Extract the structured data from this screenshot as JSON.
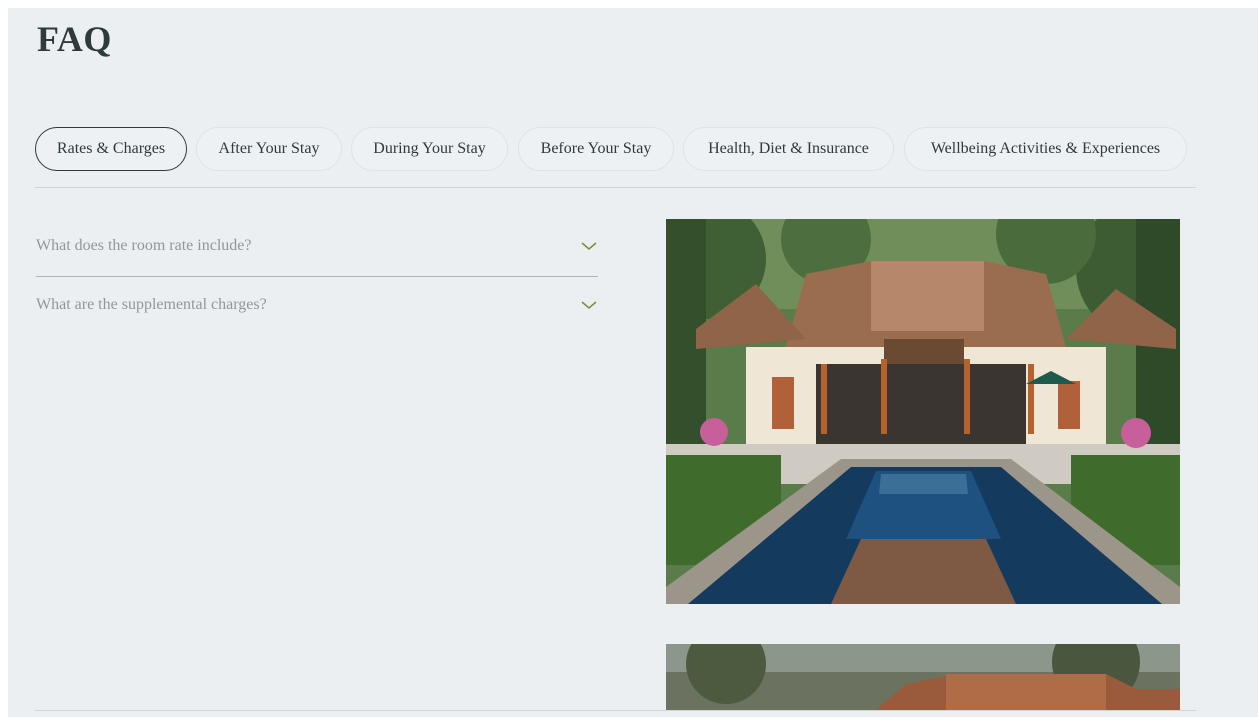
{
  "page": {
    "title": "FAQ"
  },
  "tabs": [
    {
      "label": "Rates & Charges",
      "active": true
    },
    {
      "label": "After Your Stay",
      "active": false
    },
    {
      "label": "During Your Stay",
      "active": false
    },
    {
      "label": "Before Your Stay",
      "active": false
    },
    {
      "label": "Health, Diet & Insurance",
      "active": false
    },
    {
      "label": "Wellbeing Activities & Experiences",
      "active": false
    }
  ],
  "faq": [
    {
      "question": "What does the room rate include?",
      "icon": "chevron-down-icon"
    },
    {
      "question": "What are the supplemental charges?",
      "icon": "chevron-down-icon"
    }
  ],
  "colors": {
    "accent": "#7d8f3c",
    "text": "#2f3a3a",
    "muted": "#8f979c",
    "background": "#eceff2"
  }
}
